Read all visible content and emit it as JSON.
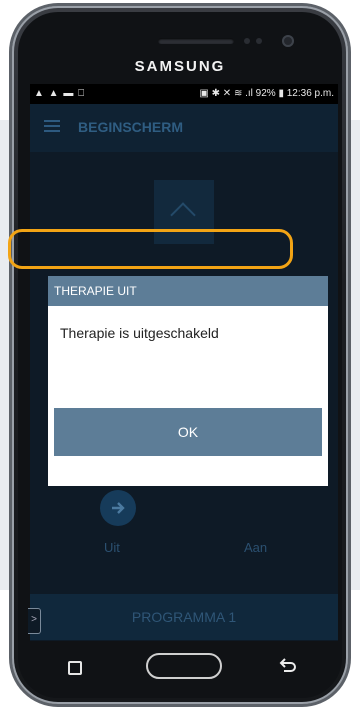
{
  "device": {
    "brand": "SAMSUNG"
  },
  "status_bar": {
    "left_icons": "▲ ▲ ▬ ⎕",
    "right_text": "▣ ✱ ✕ ≋ .ıl 92% ▮ 12:36 p.m."
  },
  "app": {
    "title": "BEGINSCHERM",
    "labels": {
      "off": "Uit",
      "on": "Aan"
    },
    "program": "PROGRAMMA 1"
  },
  "dialog": {
    "title": "THERAPIE UIT",
    "message": "Therapie is uitgeschakeld",
    "ok_label": "OK"
  },
  "side_tab": ">",
  "colors": {
    "accent": "#5d7d97",
    "highlight": "#f2a415"
  },
  "icons": [
    "menu-icon",
    "chevron-up-icon",
    "arrow-right-icon",
    "recent-apps-icon",
    "home-button",
    "back-icon"
  ]
}
